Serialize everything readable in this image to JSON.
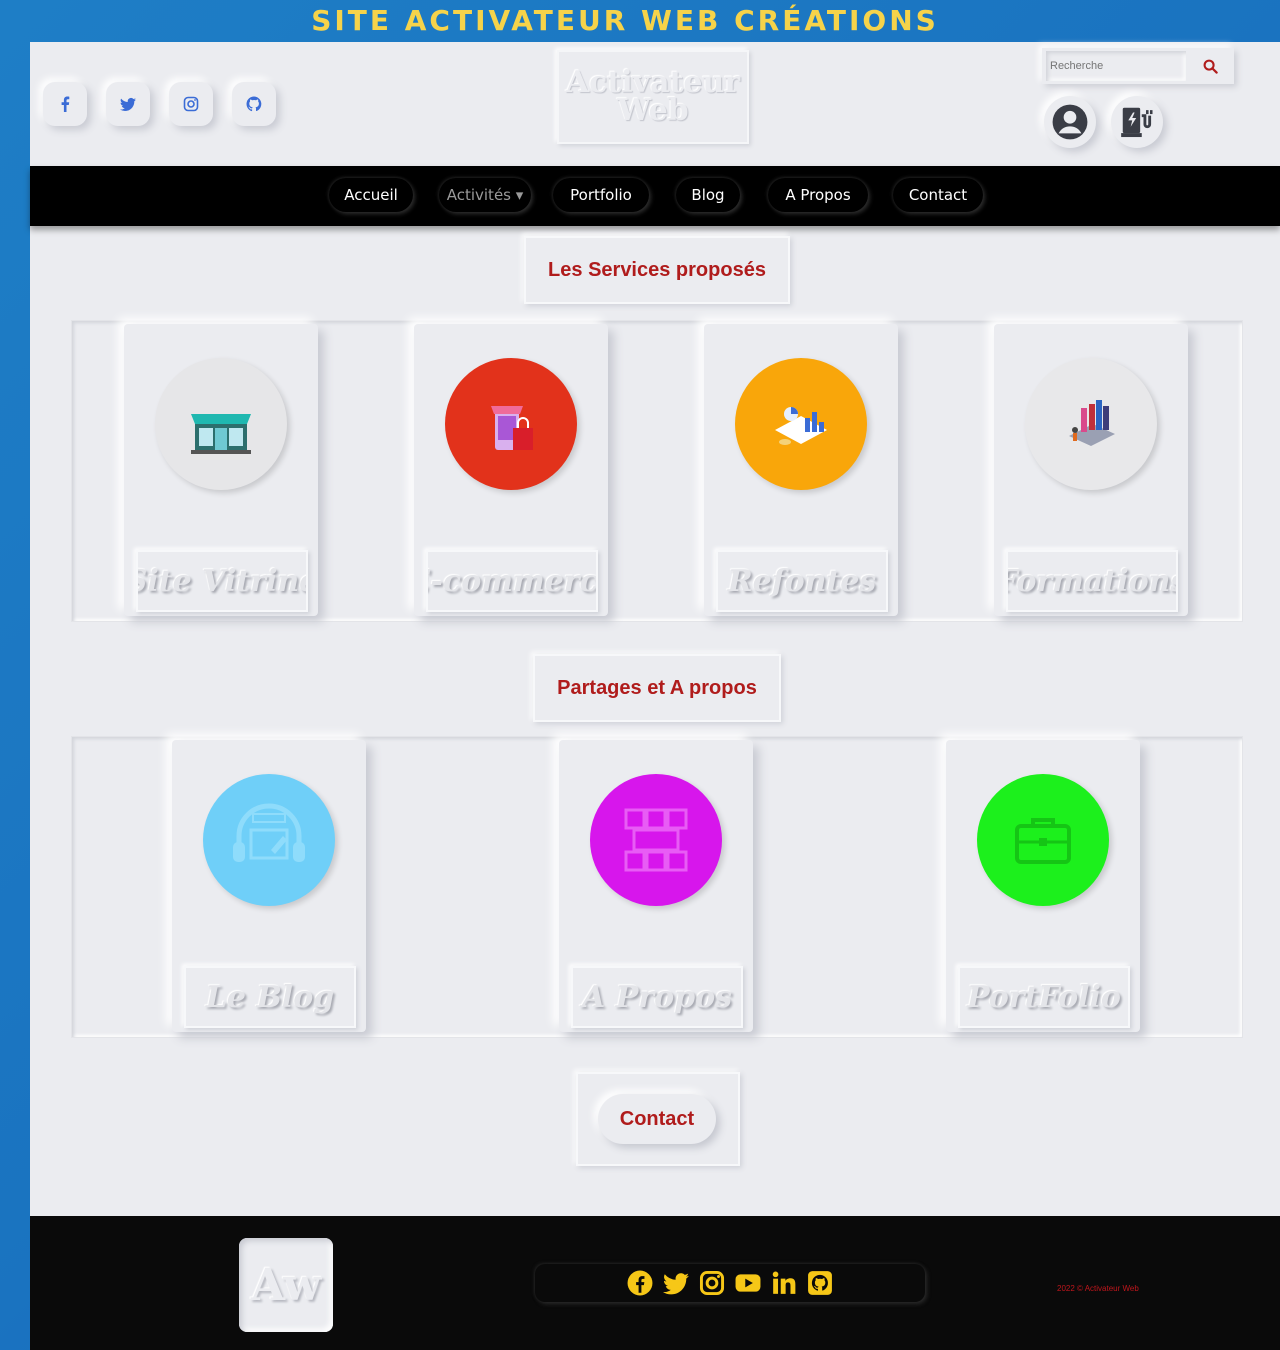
{
  "banner": {
    "title": "SITE ACTIVATEUR WEB CRÉATIONS"
  },
  "header": {
    "social": [
      {
        "icon": "facebook-icon"
      },
      {
        "icon": "twitter-icon"
      },
      {
        "icon": "instagram-icon"
      },
      {
        "icon": "github-icon"
      }
    ],
    "logo": {
      "line1": "Activateur",
      "line2": "Web"
    },
    "search": {
      "placeholder": "Recherche"
    },
    "icons": [
      "user-circle-icon",
      "charging-station-icon"
    ]
  },
  "nav": {
    "items": [
      {
        "label": "Accueil"
      },
      {
        "label": "Activités ▾"
      },
      {
        "label": "Portfolio"
      },
      {
        "label": "Blog"
      },
      {
        "label": "A Propos"
      },
      {
        "label": "Contact"
      }
    ]
  },
  "services": {
    "title": "Les Services proposés",
    "cards": [
      {
        "label": "Site Vitrine",
        "color": "#e6e6e8"
      },
      {
        "label": "E-commerce",
        "color": "#e2321b"
      },
      {
        "label": "Refontes",
        "color": "#f9a60a"
      },
      {
        "label": "Formations",
        "color": "#e8e8ea"
      }
    ]
  },
  "partages": {
    "title": "Partages et A propos",
    "cards": [
      {
        "label": "Le Blog",
        "color": "#6fcff8"
      },
      {
        "label": "A Propos",
        "color": "#d716ec"
      },
      {
        "label": "PortFolio",
        "color": "#1cf01c"
      }
    ]
  },
  "contact": {
    "label": "Contact"
  },
  "footer": {
    "logo": "Aw",
    "social": [
      "facebook-icon",
      "twitter-icon",
      "instagram-icon",
      "youtube-icon",
      "linkedin-icon",
      "github-icon"
    ],
    "copyright": "2022 © Activateur Web"
  }
}
